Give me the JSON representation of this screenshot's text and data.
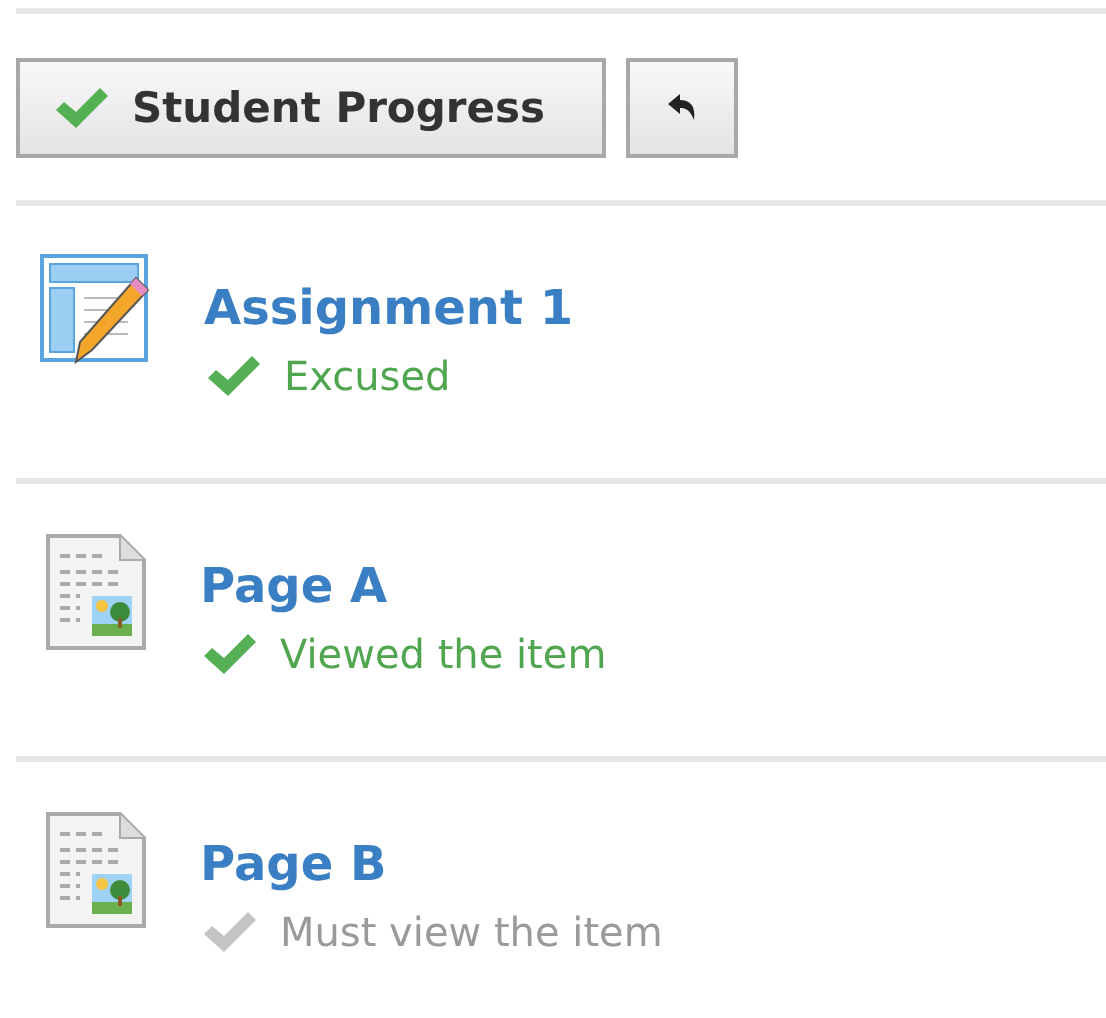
{
  "toolbar": {
    "progress_button": "Student Progress"
  },
  "items": [
    {
      "kind": "assignment",
      "title": "Assignment 1",
      "status": "Excused",
      "complete": true
    },
    {
      "kind": "page",
      "title": "Page A",
      "status": "Viewed the item",
      "complete": true
    },
    {
      "kind": "page",
      "title": "Page B",
      "status": "Must view the item",
      "complete": false
    }
  ]
}
